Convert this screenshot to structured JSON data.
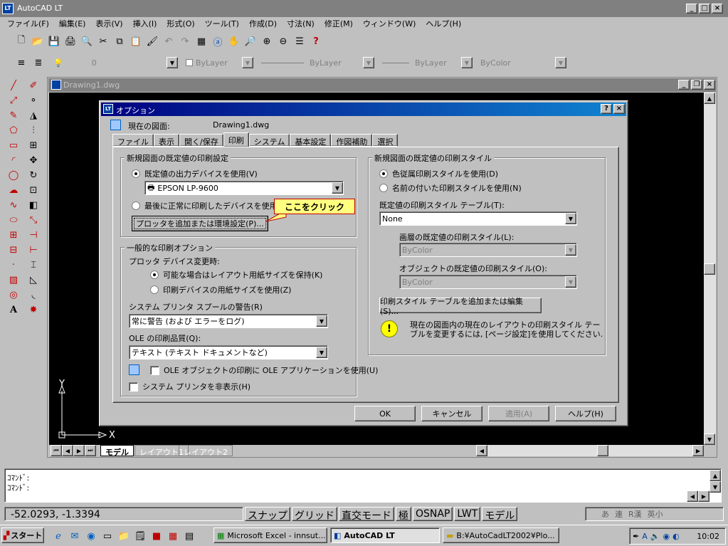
{
  "app": {
    "title": "AutoCAD LT"
  },
  "menu": [
    "ファイル(F)",
    "編集(E)",
    "表示(V)",
    "挿入(I)",
    "形式(O)",
    "ツール(T)",
    "作成(D)",
    "寸法(N)",
    "修正(M)",
    "ウィンドウ(W)",
    "ヘルプ(H)"
  ],
  "props": {
    "layer": "0",
    "color": "ByLayer",
    "linetype": "ByLayer",
    "lineweight": "ByLayer",
    "plotstyle": "ByColor"
  },
  "drawing": {
    "title": "Drawing1.dwg",
    "ucs_x": "X",
    "ucs_y": "Y"
  },
  "layout_tabs": [
    "モデル",
    "レイアウト1",
    "レイアウト2"
  ],
  "command": {
    "line1": "ｺﾏﾝﾄﾞ:",
    "line2": "ｺﾏﾝﾄﾞ:"
  },
  "status": {
    "coords": "-52.0293, -1.3394",
    "toggles": [
      "スナップ",
      "グリッド",
      "直交モード",
      "極",
      "OSNAP",
      "LWT",
      "モデル"
    ]
  },
  "ime": {
    "items": [
      "あ",
      "連",
      "R漢",
      "英小"
    ]
  },
  "dialog": {
    "title": "オプション",
    "current_label": "現在の図面:",
    "current_value": "Drawing1.dwg",
    "tabs": [
      "ファイル",
      "表示",
      "開く/保存",
      "印刷",
      "システム",
      "基本設定",
      "作図補助",
      "選択"
    ],
    "active_tab": "印刷",
    "g1": {
      "title": "新規図面の既定値の印刷設定",
      "r1": "既定値の出力デバイスを使用(V)",
      "device": "EPSON LP-9600",
      "r2": "最後に正常に印刷したデバイスを使用",
      "button": "プロッタを追加または環境設定(P)...",
      "callout": "ここをクリック"
    },
    "g2": {
      "title": "一般的な印刷オプション",
      "sub": "プロッタ デバイス変更時:",
      "r1": "可能な場合はレイアウト用紙サイズを保持(K)",
      "r2": "印刷デバイスの用紙サイズを使用(Z)",
      "spool_label": "システム プリンタ スプールの警告(R)",
      "spool_value": "常に警告 (および エラーをログ)",
      "ole_label": "OLE の印刷品質(Q):",
      "ole_value": "テキスト (テキスト ドキュメントなど)",
      "cb1": "OLE オブジェクトの印刷に OLE アプリケーションを使用(U)",
      "cb2": "システム プリンタを非表示(H)"
    },
    "g3": {
      "title": "新規図面の既定値の印刷スタイル",
      "r1": "色従属印刷スタイルを使用(D)",
      "r2": "名前の付いた印刷スタイルを使用(N)",
      "table_label": "既定値の印刷スタイル テーブル(T):",
      "table_value": "None",
      "layer_label": "画層の既定値の印刷スタイル(L):",
      "layer_value": "ByColor",
      "obj_label": "オブジェクトの既定値の印刷スタイル(O):",
      "obj_value": "ByColor",
      "button": "印刷スタイル テーブルを追加または編集(S)...",
      "info": "現在の図面内の現在のレイアウトの印刷スタイル テーブルを変更するには, [ページ設定]を使用してください."
    },
    "ok": "OK",
    "cancel": "キャンセル",
    "apply": "適用(A)",
    "help": "ヘルプ(H)"
  },
  "taskbar": {
    "start": "スタート",
    "tasks": [
      "Microsoft Excel - innsut...",
      "AutoCAD LT",
      "B:¥AutoCadLT2002¥Plo..."
    ],
    "clock": "10:02"
  },
  "colors": {
    "accent": "#000080",
    "callout_bg": "#ffff80",
    "canvas": "#000000"
  }
}
